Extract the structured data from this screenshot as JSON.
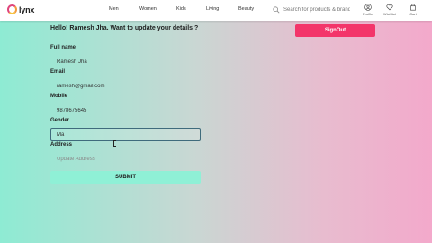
{
  "navbar": {
    "logo_text": "lynx",
    "links": [
      "Men",
      "Women",
      "Kids",
      "Living",
      "Beauty"
    ],
    "search_placeholder": "Search for products & brands",
    "actions": {
      "profile": "Profile",
      "wishlist": "Wishlist",
      "cart": "Cart"
    }
  },
  "form": {
    "greeting": "Hello! Ramesh Jha. Want to update your details ?",
    "signout_label": "SignOut",
    "full_name": {
      "label": "Full name",
      "value": "Ramesh Jha"
    },
    "email": {
      "label": "Email",
      "value": "ramesh@gmail.com"
    },
    "mobile": {
      "label": "Mobile",
      "value": "9878675645"
    },
    "gender": {
      "label": "Gender",
      "value": "Ma"
    },
    "address": {
      "label": "Address",
      "value": "",
      "placeholder": "Update Address"
    },
    "submit_label": "SUBMIT"
  },
  "colors": {
    "accent_pink": "#f3356a",
    "submit_mint": "#8ff0d6",
    "gradient_left": "#8eebd3",
    "gradient_right": "#f3a9cb"
  }
}
